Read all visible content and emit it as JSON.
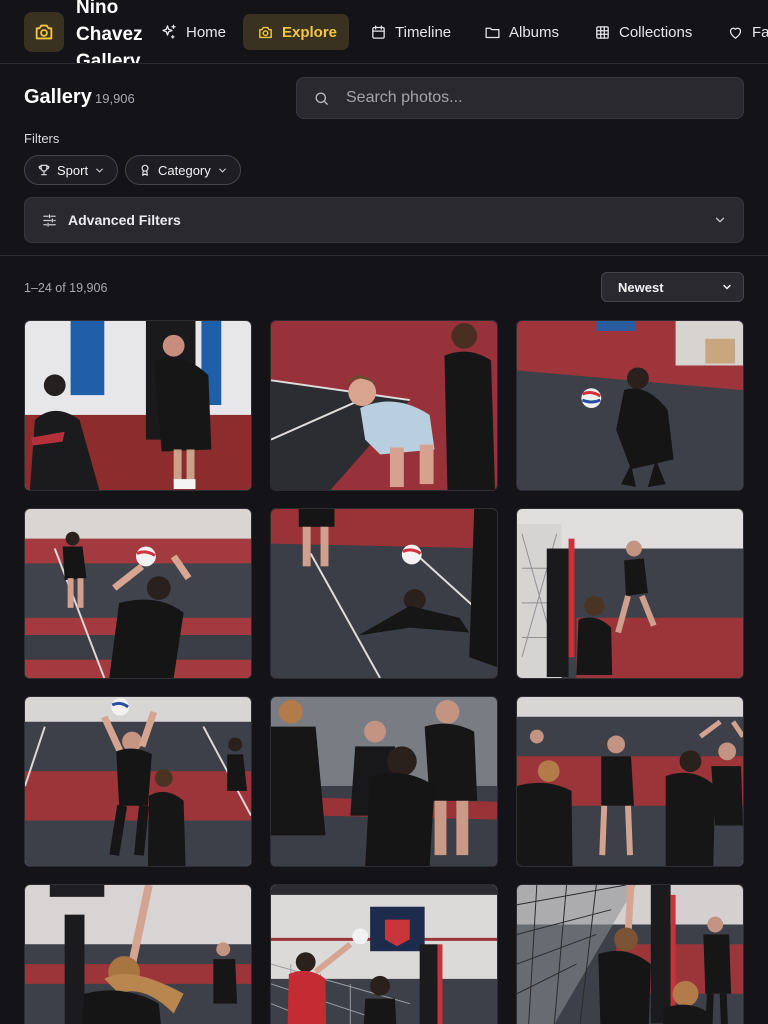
{
  "nav": {
    "brand": "Nino Chavez Gallery",
    "items": [
      {
        "label": "Home",
        "icon": "sparkles-icon"
      },
      {
        "label": "Explore",
        "icon": "camera-icon",
        "active": true
      },
      {
        "label": "Timeline",
        "icon": "calendar-icon"
      },
      {
        "label": "Albums",
        "icon": "folder-icon"
      },
      {
        "label": "Collections",
        "icon": "grid-icon"
      },
      {
        "label": "Fa",
        "icon": "heart-icon"
      }
    ],
    "accent": "#f5c542"
  },
  "header": {
    "title": "Gallery",
    "count": "19,906",
    "search_placeholder": "Search photos..."
  },
  "filters": {
    "label": "Filters",
    "chips": [
      {
        "label": "Sport",
        "icon": "trophy-icon"
      },
      {
        "label": "Category",
        "icon": "award-icon"
      }
    ],
    "advanced_label": "Advanced Filters"
  },
  "results": {
    "range_text": "1–24 of 19,906",
    "sort_value": "Newest"
  },
  "photos": [
    {
      "scene": "players-wall"
    },
    {
      "scene": "player-crouch"
    },
    {
      "scene": "player-bump"
    },
    {
      "scene": "player-set"
    },
    {
      "scene": "player-dive"
    },
    {
      "scene": "player-spike"
    },
    {
      "scene": "player-set-court"
    },
    {
      "scene": "team-huddle"
    },
    {
      "scene": "team-celebrate"
    },
    {
      "scene": "player-hair"
    },
    {
      "scene": "net-play"
    },
    {
      "scene": "net-corner"
    }
  ]
}
